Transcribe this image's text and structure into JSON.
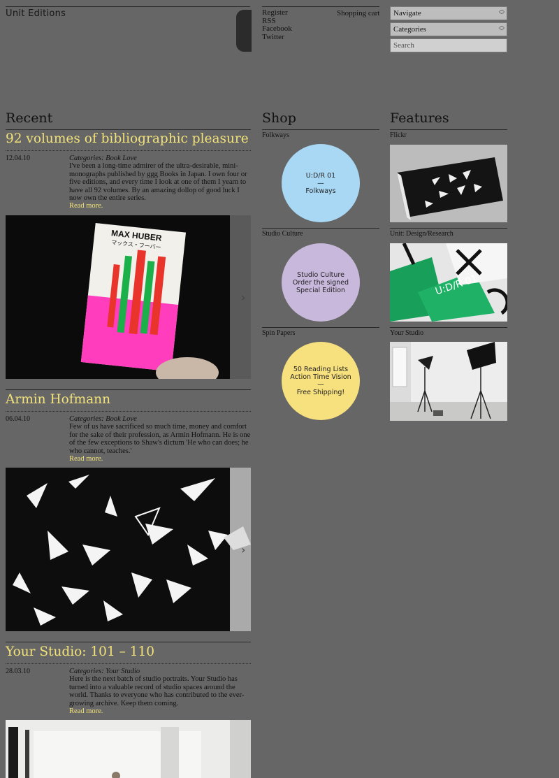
{
  "header": {
    "logo": "Unit Editions",
    "links": [
      "Register",
      "RSS",
      "Facebook",
      "Twitter"
    ],
    "cart": "Shopping cart",
    "navigate": "Navigate",
    "categories": "Categories",
    "search_placeholder": "Search"
  },
  "columns": {
    "recent": "Recent",
    "shop": "Shop",
    "features": "Features"
  },
  "posts": [
    {
      "title": "92 volumes of bibliographic pleasure",
      "date": "12.04.10",
      "category": "Categories: Book Love",
      "body": "I've been a long-time admirer of the ultra-desirable, mini-monographs published by ggg Books in Japan. I own four or five editions, and every time I look at one of them I yearn to have all 92 volumes. By an amazing dollop of good luck I now own the entire series.",
      "more": "Read more.",
      "book_author": "MAX HUBER",
      "book_author_jp": "マックス・フーバー"
    },
    {
      "title": "Armin Hofmann",
      "date": "06.04.10",
      "category": "Categories: Book Love",
      "body": "Few of us have sacrificed so much time, money and comfort for the sake of their profession, as Armin Hofmann. He is one of the few exceptions to Shaw's dictum 'He who can does; he who cannot, teaches.'",
      "more": "Read more."
    },
    {
      "title": "Your Studio: 101 – 110",
      "date": "28.03.10",
      "category": "Categories: Your Studio",
      "body": "Here is the next batch of studio portraits. Your Studio has turned into a valuable record of studio spaces around the world. Thanks to everyone who has contributed to the ever-growing archive. Keep them coming.",
      "more": "Read more."
    }
  ],
  "shop": [
    {
      "label": "Folkways",
      "lines": [
        "U:D/R 01",
        "—",
        "Folkways"
      ],
      "color": "#a9d8f5"
    },
    {
      "label": "Studio Culture",
      "lines": [
        "Studio Culture",
        "Order the signed",
        "Special Edition"
      ],
      "color": "#c8b8dc"
    },
    {
      "label": "Spin Papers",
      "lines": [
        "50 Reading Lists",
        "Action Time Vision",
        "—",
        "Free Shipping!"
      ],
      "color": "#f7e07e"
    }
  ],
  "features": [
    {
      "label": "Flickr"
    },
    {
      "label": "Unit: Design/Research",
      "cover_text": "U:D/R 01"
    },
    {
      "label": "Your Studio"
    }
  ],
  "icons": {
    "next": "chevron-right-icon",
    "select_arrows": "updown-arrows-icon"
  }
}
